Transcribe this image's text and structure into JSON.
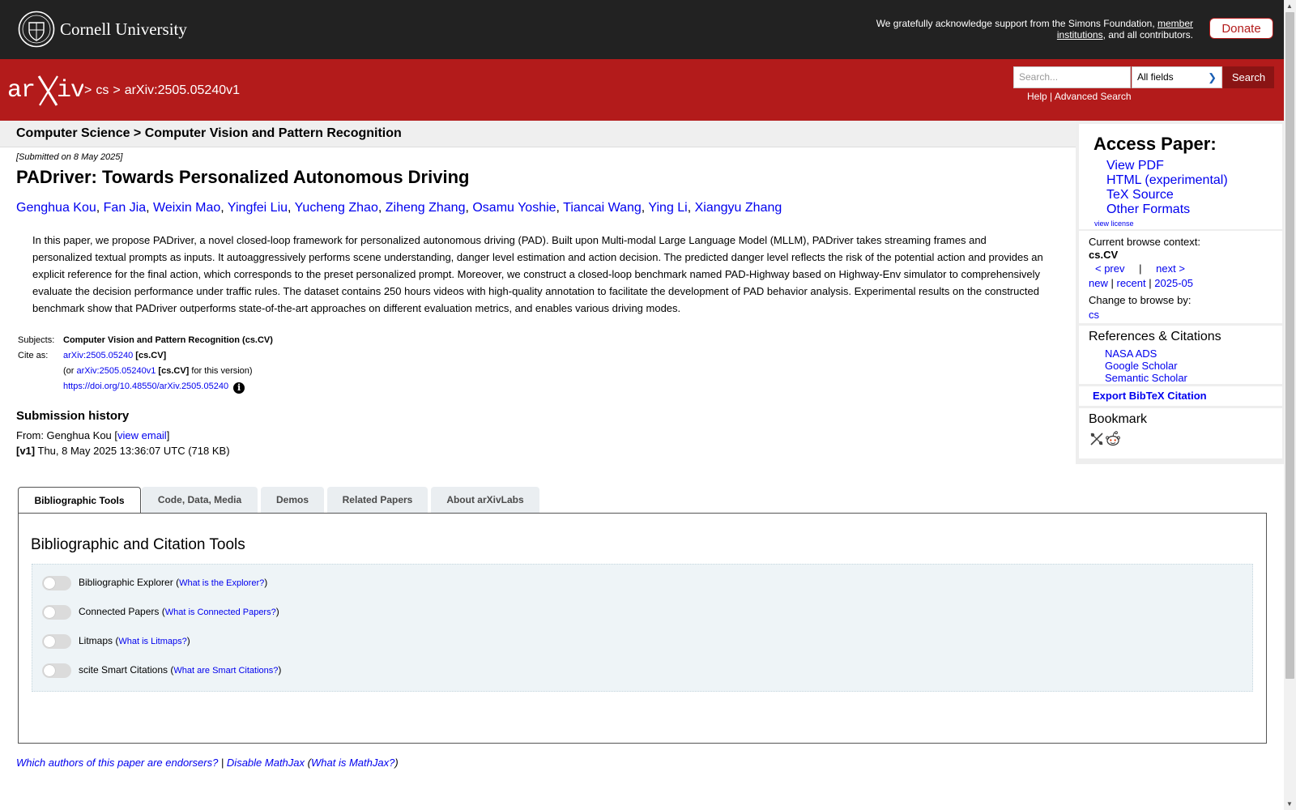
{
  "topbar": {
    "org_name": "Cornell University",
    "ack_text": "We gratefully acknowledge support from the Simons Foundation, ",
    "ack_link": "member institutions",
    "ack_tail": ", and all contributors.",
    "donate_label": "Donate"
  },
  "header": {
    "logo_text": "arXiv",
    "breadcrumb": [
      ">",
      "cs",
      ">",
      "arXiv:2505.05240v1"
    ],
    "search_placeholder": "Search...",
    "search_field": "All fields",
    "search_button": "Search",
    "help_link": "Help",
    "separator": "|",
    "advanced_link": "Advanced Search"
  },
  "subheader": "Computer Science > Computer Vision and Pattern Recognition",
  "paper": {
    "submitted": "[Submitted on 8 May 2025]",
    "title": "PADriver: Towards Personalized Autonomous Driving",
    "authors": [
      "Genghua Kou",
      "Fan Jia",
      "Weixin Mao",
      "Yingfei Liu",
      "Yucheng Zhao",
      "Ziheng Zhang",
      "Osamu Yoshie",
      "Tiancai Wang",
      "Ying Li",
      "Xiangyu Zhang"
    ],
    "author_sep": ", ",
    "abstract": "In this paper, we propose PADriver, a novel closed-loop framework for personalized autonomous driving (PAD). Built upon Multi-modal Large Language Model (MLLM), PADriver takes streaming frames and personalized textual prompts as inputs. It autoaggressively performs scene understanding, danger level estimation and action decision. The predicted danger level reflects the risk of the potential action and provides an explicit reference for the final action, which corresponds to the preset personalized prompt. Moreover, we construct a closed-loop benchmark named PAD-Highway based on Highway-Env simulator to comprehensively evaluate the decision performance under traffic rules. The dataset contains 250 hours videos with high-quality annotation to facilitate the development of PAD behavior analysis. Experimental results on the constructed benchmark show that PADriver outperforms state-of-the-art approaches on different evaluation metrics, and enables various driving modes."
  },
  "meta": {
    "subjects_label": "Subjects:",
    "subjects_value": "Computer Vision and Pattern Recognition (cs.CV)",
    "cite_label": "Cite as:",
    "cite_id": "arXiv:2505.05240",
    "cite_cat": "[cs.CV]",
    "or_prefix": "(or ",
    "cite_id_v": "arXiv:2505.05240v1",
    "cite_cat_v": "[cs.CV]",
    "or_suffix": " for this version)",
    "doi": "https://doi.org/10.48550/arXiv.2505.05240",
    "info_icon": "i"
  },
  "history": {
    "title": "Submission history",
    "from_prefix": "From: Genghua Kou [",
    "view_email": "view email",
    "from_suffix": "]",
    "v1_label": "[v1]",
    "v1_text": " Thu, 8 May 2025 13:36:07 UTC (718 KB)"
  },
  "sidebar": {
    "access_title": "Access Paper:",
    "access_links": [
      "View PDF",
      "HTML (experimental)",
      "TeX Source",
      "Other Formats"
    ],
    "view_license": "view license",
    "browse_label": "Current browse context:",
    "browse_context": "cs.CV",
    "prev": "< prev",
    "pipe": "|",
    "next": "next >",
    "new": "new",
    "recent": "recent",
    "month": "2025-05",
    "change_label": "Change to browse by:",
    "change_cs": "cs",
    "refs_title": "References & Citations",
    "refs_links": [
      "NASA ADS",
      "Google Scholar",
      "Semantic Scholar"
    ],
    "export_bibtex": "Export BibTeX Citation",
    "bookmark_title": "Bookmark"
  },
  "tabs": {
    "items": [
      "Bibliographic Tools",
      "Code, Data, Media",
      "Demos",
      "Related Papers",
      "About arXivLabs"
    ],
    "active_index": 0,
    "panel_title": "Bibliographic and Citation Tools",
    "toggles": [
      {
        "label": "Bibliographic Explorer",
        "link": "What is the Explorer?"
      },
      {
        "label": "Connected Papers",
        "link": "What is Connected Papers?"
      },
      {
        "label": "Litmaps",
        "link": "What is Litmaps?"
      },
      {
        "label": "scite Smart Citations",
        "link": "What are Smart Citations?"
      }
    ]
  },
  "footer": {
    "endorsers": "Which authors of this paper are endorsers?",
    "sep": " | ",
    "disable_mathjax": "Disable MathJax",
    "what_mathjax": "What is MathJax?"
  },
  "colors": {
    "arxiv_red": "#b31b1b",
    "topbar": "#222222",
    "link": "#0000ee"
  }
}
